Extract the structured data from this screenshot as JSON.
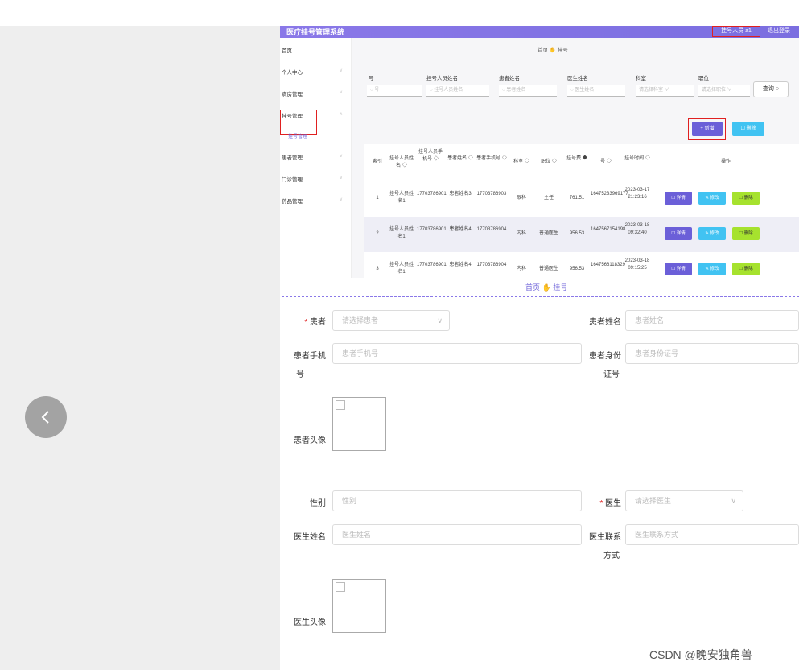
{
  "top": {
    "app_title": "医疗挂号管理系统",
    "user": "挂号人员 a1",
    "logout": "退出登录",
    "breadcrumb": {
      "home": "首页",
      "current": "挂号"
    },
    "sidebar": {
      "items": [
        {
          "label": "首页",
          "arrow": ""
        },
        {
          "label": "个人中心",
          "arrow": "∨"
        },
        {
          "label": "病房管理",
          "arrow": "∨"
        },
        {
          "label": "挂号管理",
          "arrow": "∧"
        },
        {
          "label": "患者管理",
          "arrow": "∨"
        },
        {
          "label": "门诊管理",
          "arrow": "∨"
        },
        {
          "label": "药品管理",
          "arrow": "∨"
        }
      ],
      "sub_item": "挂号管理"
    },
    "filters": [
      {
        "label": "号",
        "placeholder": "号"
      },
      {
        "label": "挂号人员姓名",
        "placeholder": "挂号人员姓名"
      },
      {
        "label": "患者姓名",
        "placeholder": "患者姓名"
      },
      {
        "label": "医生姓名",
        "placeholder": "医生姓名"
      },
      {
        "label": "科室",
        "placeholder": "请选择科室"
      },
      {
        "label": "职位",
        "placeholder": "请选择职位"
      }
    ],
    "query_button": "查询 ○",
    "add_button": "+ 新增",
    "delete_button": "☐ 删除",
    "columns": [
      "索引",
      "挂号人员姓名 ◇",
      "挂号人员手机号 ◇",
      "患者姓名 ◇",
      "患者手机号 ◇",
      "科室 ◇",
      "职位 ◇",
      "挂号费 ◆",
      "号 ◇",
      "挂号时间 ◇",
      "操作"
    ],
    "rows": [
      [
        "1",
        "挂号人员姓名1",
        "17703786901",
        "患者姓名3",
        "17703786903",
        "眼科",
        "主任",
        "761.51",
        "16475233969177",
        "2023-03-17 21:23:16"
      ],
      [
        "2",
        "挂号人员姓名1",
        "17703786901",
        "患者姓名4",
        "17703786904",
        "内科",
        "普通医生",
        "956.53",
        "1647567154198",
        "2023-03-18 09:32:40"
      ],
      [
        "3",
        "挂号人员姓名1",
        "17703786901",
        "患者姓名4",
        "17703786904",
        "内科",
        "普通医生",
        "956.53",
        "1647566118329",
        "2023-03-18 09:15:25"
      ]
    ],
    "ops": {
      "detail": "☐ 详情",
      "edit": "✎ 修改",
      "remove": "☐ 删除"
    }
  },
  "form": {
    "breadcrumb": {
      "home": "首页",
      "current": "挂号"
    },
    "patient_label": "患者",
    "patient_placeholder": "请选择患者",
    "patient_name_label": "患者姓名",
    "patient_name_placeholder": "患者姓名",
    "patient_phone_label_1": "患者手机",
    "patient_phone_label_2": "号",
    "patient_phone_placeholder": "患者手机号",
    "patient_id_label_1": "患者身份",
    "patient_id_label_2": "证号",
    "patient_id_placeholder": "患者身份证号",
    "avatar_label": "患者头像",
    "gender_label": "性别",
    "gender_placeholder": "性别",
    "doctor_label": "医生",
    "doctor_placeholder": "请选择医生",
    "doctor_name_label": "医生姓名",
    "doctor_name_placeholder": "医生姓名",
    "doctor_contact_label_1": "医生联系",
    "doctor_contact_label_2": "方式",
    "doctor_contact_placeholder": "医生联系方式",
    "doctor_avatar_label": "医生头像"
  },
  "watermark": "CSDN @晚安独角兽"
}
